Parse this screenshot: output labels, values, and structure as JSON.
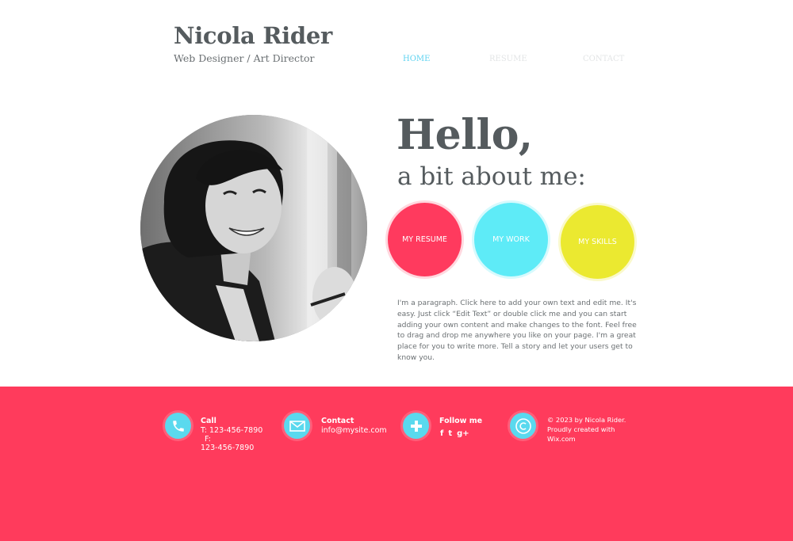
{
  "header": {
    "name": "Nicola Rider",
    "tagline": "Web Designer / Art Director"
  },
  "nav": {
    "items": [
      "HOME",
      "RESUME",
      "CONTACT"
    ],
    "active": "HOME"
  },
  "hero": {
    "title": "Hello,",
    "subtitle": "a bit about me:",
    "buttons": [
      {
        "label": "MY RESUME",
        "color": "#ff3a5e"
      },
      {
        "label": "MY WORK",
        "color": "#5eebf7"
      },
      {
        "label": "MY SKILLS",
        "color": "#ebe930"
      }
    ],
    "paragraph": "I'm a paragraph. Click here to add your own text and edit me. It's easy. Just click “Edit Text” or double click me and you can start adding your own content and make changes to the font. Feel free to drag and drop me anywhere you like on your page. I'm a great place for you to write more. Tell a story and let your users get to know you."
  },
  "footer": {
    "background": "#ff3b5c",
    "icon_color": "#5ad9ee",
    "call": {
      "title": "Call",
      "phone": "T: 123-456-7890",
      "fax_label": "F:",
      "fax": "123-456-7890",
      "icon": "phone-icon"
    },
    "contact": {
      "title": "Contact",
      "email": "info@mysite.com",
      "icon": "envelope-icon"
    },
    "follow": {
      "title": "Follow me",
      "icon": "plus-icon",
      "social": [
        "f",
        "t",
        "g+"
      ]
    },
    "copyright": {
      "line1": "© 2023 by Nicola Rider.",
      "line2": "Proudly created with",
      "line3": "Wix.com",
      "icon": "copyright-icon"
    }
  }
}
